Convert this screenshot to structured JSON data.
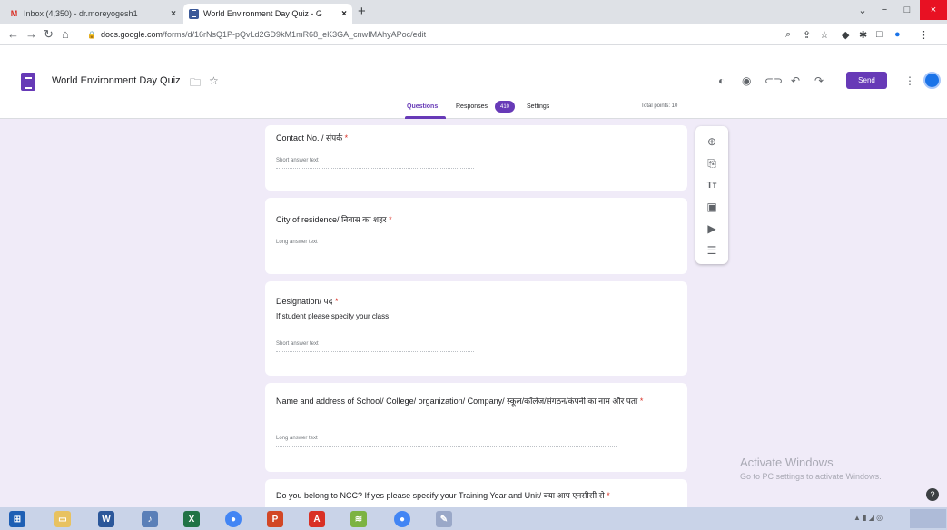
{
  "browser": {
    "tabs": [
      {
        "title": "Inbox (4,350) - dr.moreyogesh1",
        "active": false
      },
      {
        "title": "World Environment Day Quiz - G",
        "active": true
      }
    ],
    "new_tab_glyph": "+",
    "window_controls": {
      "minimize": "−",
      "maximize": "□",
      "close": "×",
      "dropdown": "⌄"
    },
    "url": {
      "domain": "docs.google.com",
      "path": "/forms/d/16rNsQ1P-pQvLd2GD9kM1mR68_eK3GA_cnwIMAhyAPoc/edit"
    }
  },
  "header": {
    "form_title": "World Environment Day Quiz",
    "send_label": "Send",
    "tabs": {
      "questions": "Questions",
      "responses": "Responses",
      "settings": "Settings"
    },
    "responses_count": "410",
    "total_points": "Total points: 10"
  },
  "questions": [
    {
      "title": "Contact No. / संपर्क",
      "required": "*",
      "answer_placeholder": "Short answer text"
    },
    {
      "title": "City of residence/ निवास का शहर",
      "required": "*",
      "answer_placeholder": "Long answer text"
    },
    {
      "title": "Designation/ पद",
      "required": "*",
      "description": "If student please specify your class",
      "answer_placeholder": "Short answer text"
    },
    {
      "title": "Name and address of School/ College/ organization/ Company/ स्कूल/कॉलेज/संगठन/कंपनी का नाम और पता",
      "required": "*",
      "answer_placeholder": "Long answer text"
    },
    {
      "title": "Do you belong to NCC? If yes please specify your Training Year and Unit/ क्या आप एनसीसी से",
      "required": "*"
    }
  ],
  "watermark": {
    "line1": "Activate Windows",
    "line2": "Go to PC settings to activate Windows."
  },
  "help_glyph": "?",
  "colors": {
    "accent": "#673ab7",
    "page_bg": "#f0ebf8",
    "required": "#d93025"
  },
  "icons": {
    "toolbar": [
      "add-question-icon",
      "import-questions-icon",
      "add-title-icon",
      "add-image-icon",
      "add-video-icon",
      "add-section-icon"
    ],
    "header": [
      "customize-theme-icon",
      "preview-icon",
      "link-icon",
      "undo-icon",
      "redo-icon",
      "more-icon"
    ]
  }
}
